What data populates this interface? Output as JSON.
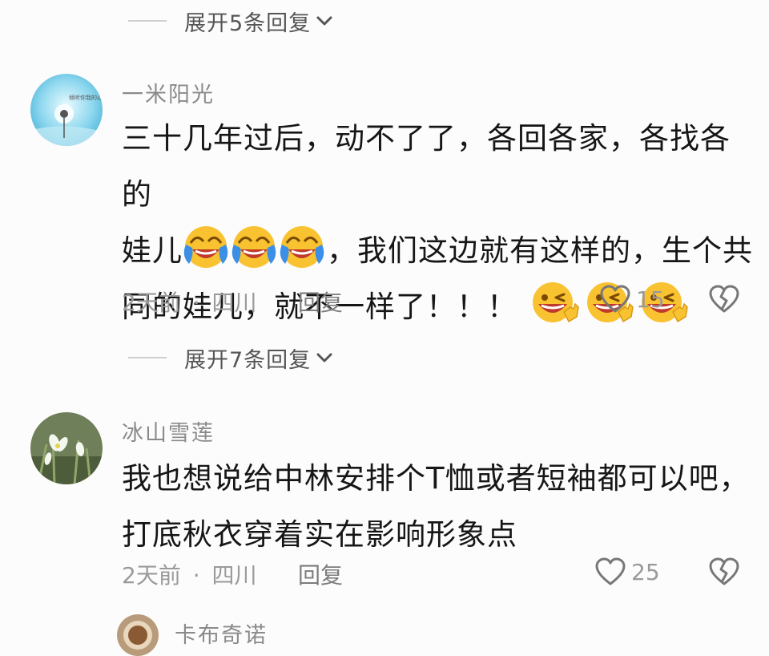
{
  "expand_replies": [
    {
      "text": "展开5条回复"
    },
    {
      "text": "展开7条回复"
    }
  ],
  "comments": [
    {
      "username": "一米阳光",
      "avatar_text": "倾听你我的心声",
      "lines": [
        "三十几年过后，动不了了，各回各家，各找各的",
        "娃儿",
        "，我们这边就有这样的，生个共",
        "同的娃儿，就不一样了！！！"
      ],
      "emoji_set_1": "laughing-crying-face x3",
      "emoji_set_2": "laughing-wink-face x3",
      "time": "2天前",
      "location": "四川",
      "reply_label": "回复",
      "likes": "15"
    },
    {
      "username": "冰山雪莲",
      "lines": [
        "我也想说给中林安排个T恤或者短袖都可以吧，",
        "打底秋衣穿着实在影响形象点"
      ],
      "time": "2天前",
      "location": "四川",
      "reply_label": "回复",
      "likes": "25"
    },
    {
      "username": "卡布奇诺"
    }
  ],
  "separator": "·",
  "colors": {
    "background": "#fdfcfc",
    "text": "#161616",
    "muted": "#9a9a9a",
    "emoji_yellow": "#f9c231",
    "emoji_blue": "#3b8fe6"
  }
}
